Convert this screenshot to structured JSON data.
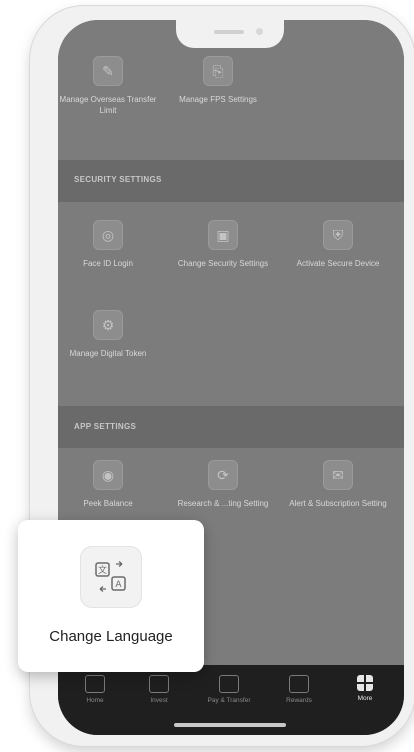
{
  "sections": {
    "top": {
      "items": [
        {
          "label": "Manage Overseas Transfer Limit",
          "icon": "transfer-limit-icon"
        },
        {
          "label": "Manage FPS Settings",
          "icon": "fps-settings-icon"
        }
      ]
    },
    "security": {
      "title": "SECURITY SETTINGS",
      "items": [
        {
          "label": "Face ID Login",
          "icon": "face-id-icon"
        },
        {
          "label": "Change Security Settings",
          "icon": "security-settings-icon"
        },
        {
          "label": "Activate Secure Device",
          "icon": "secure-device-icon"
        },
        {
          "label": "Manage Digital Token",
          "icon": "digital-token-icon"
        }
      ]
    },
    "app": {
      "title": "APP SETTINGS",
      "items": [
        {
          "label": "Peek Balance",
          "icon": "eye-icon"
        },
        {
          "label": "Research & ...ting Setting",
          "icon": "research-icon"
        },
        {
          "label": "Alert & Subscription Setting",
          "icon": "alert-icon"
        }
      ]
    }
  },
  "highlight": {
    "label": "Change Language",
    "icon": "translate-icon"
  },
  "nav": [
    {
      "label": "Home",
      "icon": "home-icon"
    },
    {
      "label": "Invest",
      "icon": "invest-icon"
    },
    {
      "label": "Pay & Transfer",
      "icon": "pay-transfer-icon"
    },
    {
      "label": "Rewards",
      "icon": "rewards-icon"
    },
    {
      "label": "More",
      "icon": "grid-icon"
    }
  ]
}
